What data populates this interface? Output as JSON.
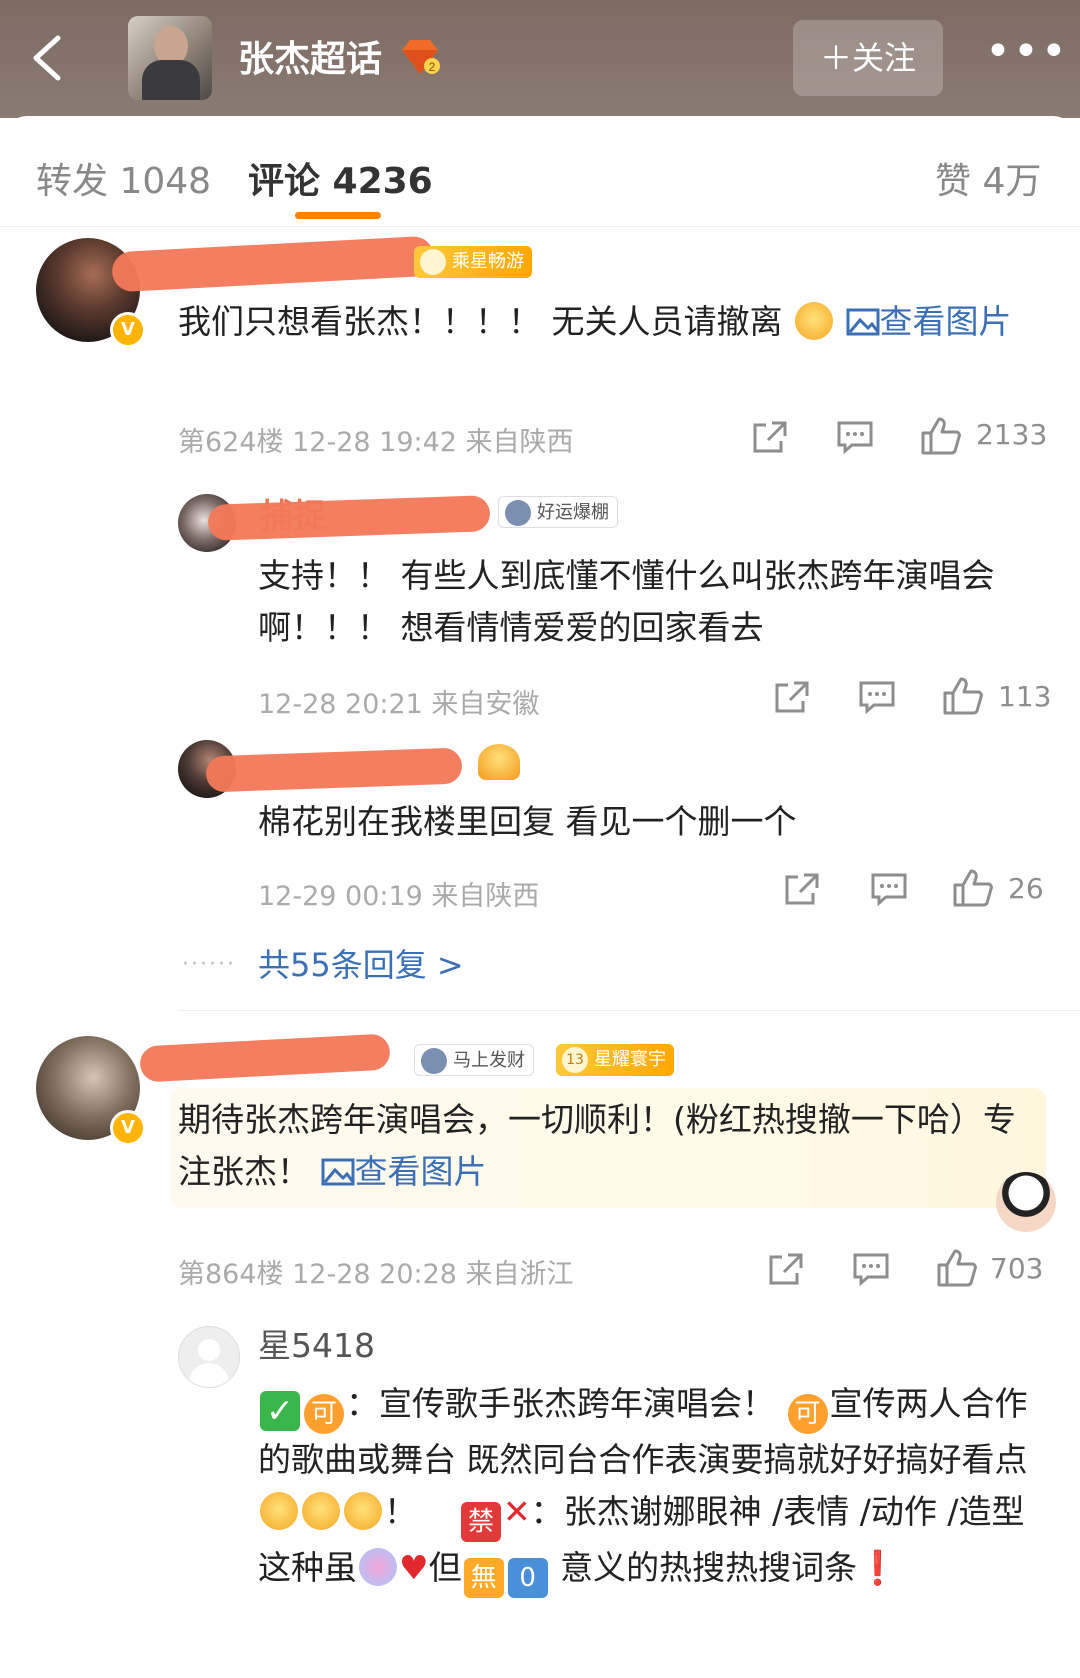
{
  "header": {
    "back_icon": "chevron-left-icon",
    "title": "张杰超话",
    "level_badge": "2",
    "follow_label": "＋关注",
    "more_label": "•••"
  },
  "tabs": {
    "repost": "转发 1048",
    "comments": "评论 4236",
    "likes": "赞 4万",
    "active": "comments",
    "accent_color": "#ff8200"
  },
  "comments": [
    {
      "badge": "乘星畅游",
      "text": "我们只想看张杰！！！！ 无关人员请撤离",
      "view_image": "查看图片",
      "meta": "第624楼 12-28 19:42 来自陕西",
      "likes": "2133"
    },
    {
      "name_visible": "捕捉",
      "badge": "好运爆棚",
      "text": "支持！！ 有些人到底懂不懂什么叫张杰跨年演唱会啊！！！ 想看情情爱爱的回家看去",
      "meta": "12-28 20:21 来自安徽",
      "likes": "113"
    },
    {
      "text": "棉花别在我楼里回复 看见一个删一个",
      "meta": "12-29 00:19 来自陕西",
      "likes": "26"
    },
    {
      "badge_1": "马上发财",
      "badge_2": "星耀寰宇",
      "badge_2_level": "13",
      "text": "期待张杰跨年演唱会，一切顺利！(粉红热搜撤一下哈）专注张杰！",
      "view_image": "查看图片",
      "meta": "第864楼 12-28 20:28 来自浙江",
      "likes": "703"
    },
    {
      "name": "星5418",
      "text_1": "：宣传歌手张杰跨年演唱会！",
      "text_2": "宣传两人合作的歌曲或舞台  既然同台合作表演要搞就好好搞好看点",
      "text_3": "！",
      "text_4": "：张杰谢娜眼神 /表情 /动作 /造型 这种虽",
      "text_5": "但",
      "text_6": "意义的热搜热搜词条",
      "emoji_check": "✓",
      "emoji_ke": "可",
      "emoji_jin": "禁",
      "emoji_x": "✕",
      "emoji_wu": "無",
      "emoji_zero": "0",
      "emoji_heart": "♥",
      "emoji_bang": "❗"
    }
  ],
  "more_replies": "共55条回复 >",
  "more_dots": "······"
}
